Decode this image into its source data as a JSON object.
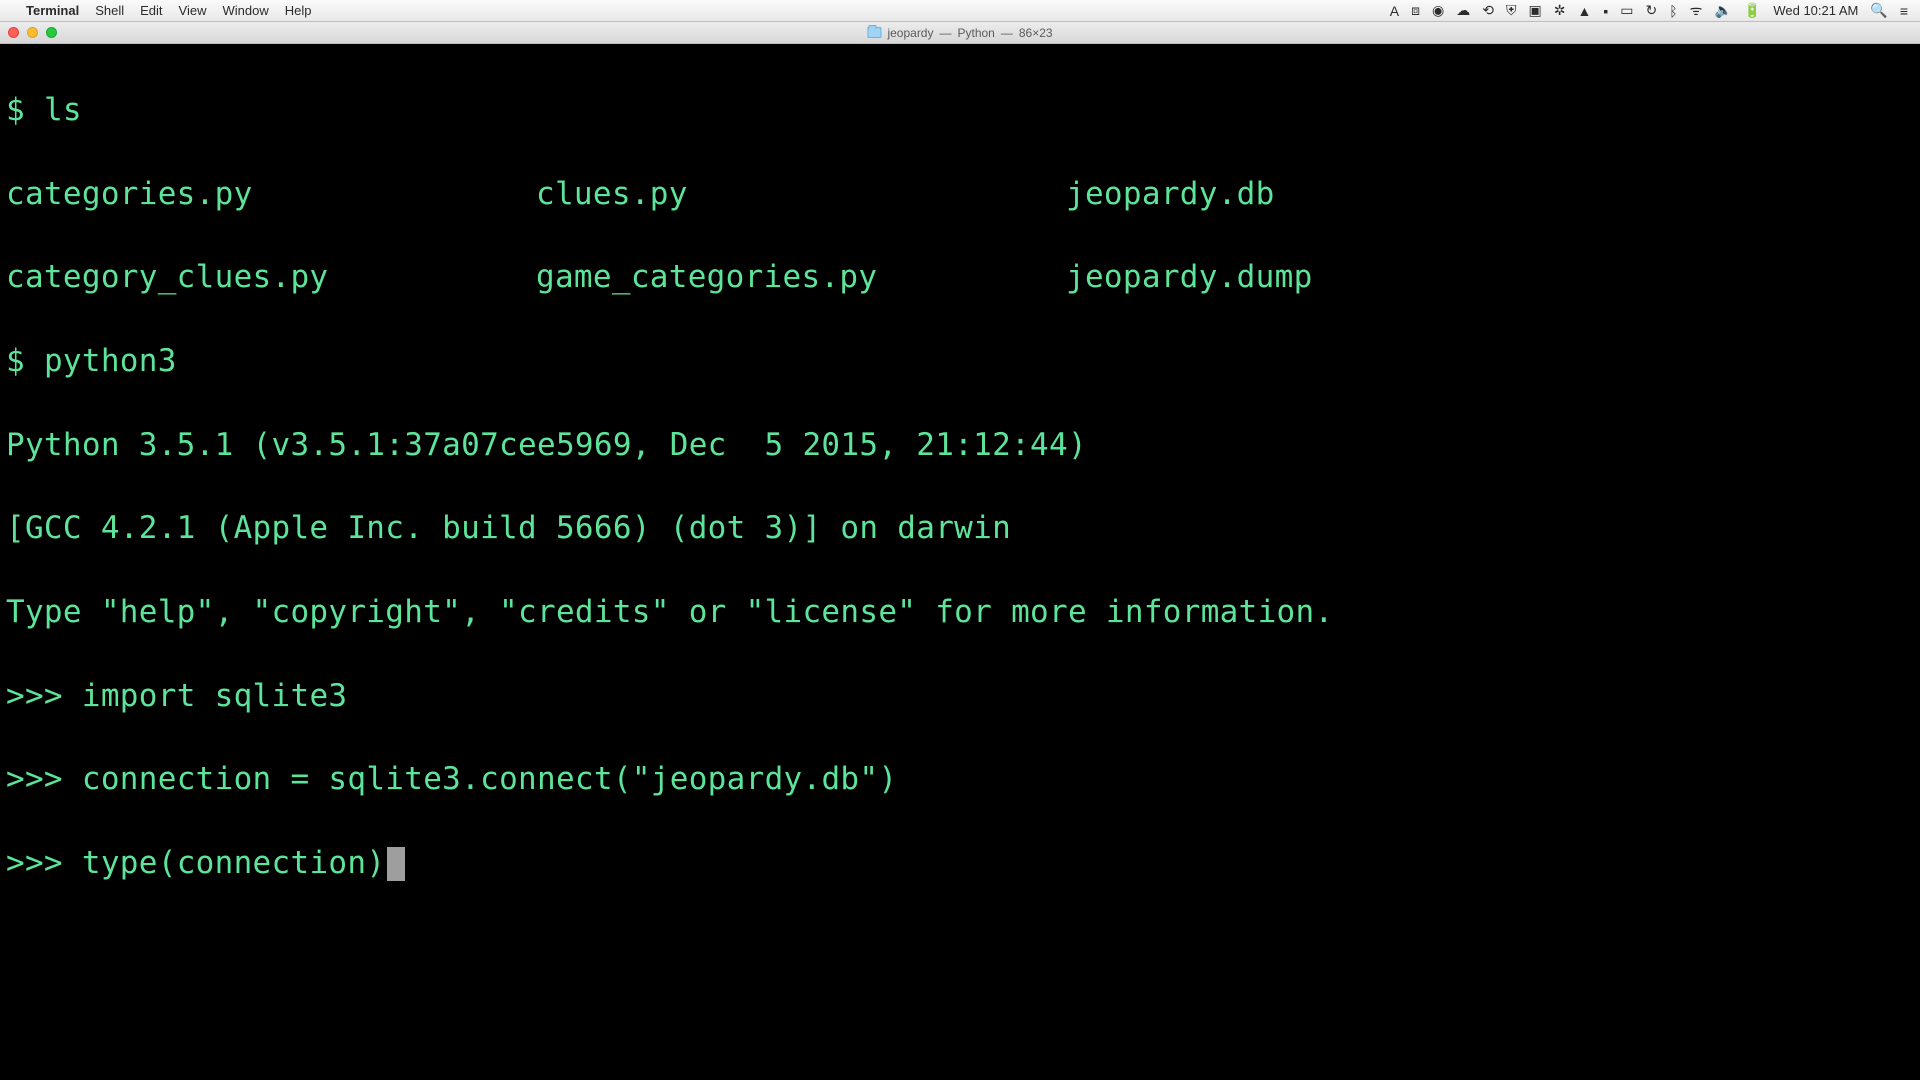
{
  "menubar": {
    "app_name": "Terminal",
    "items": [
      "Shell",
      "Edit",
      "View",
      "Window",
      "Help"
    ],
    "clock": "Wed 10:21 AM"
  },
  "titlebar": {
    "folder": "jeopardy",
    "process": "Python",
    "size": "86×23"
  },
  "terminal": {
    "prompt": "$",
    "py_prompt": ">>>",
    "cmd_ls": "ls",
    "ls_rows": [
      {
        "c1": "categories.py",
        "c2": "clues.py",
        "c3": "jeopardy.db"
      },
      {
        "c1": "category_clues.py",
        "c2": "game_categories.py",
        "c3": "jeopardy.dump"
      }
    ],
    "cmd_python": "python3",
    "py_banner1": "Python 3.5.1 (v3.5.1:37a07cee5969, Dec  5 2015, 21:12:44)",
    "py_banner2": "[GCC 4.2.1 (Apple Inc. build 5666) (dot 3)] on darwin",
    "py_banner3": "Type \"help\", \"copyright\", \"credits\" or \"license\" for more information.",
    "py_lines": [
      "import sqlite3",
      "connection = sqlite3.connect(\"jeopardy.db\")",
      "type(connection)"
    ]
  }
}
